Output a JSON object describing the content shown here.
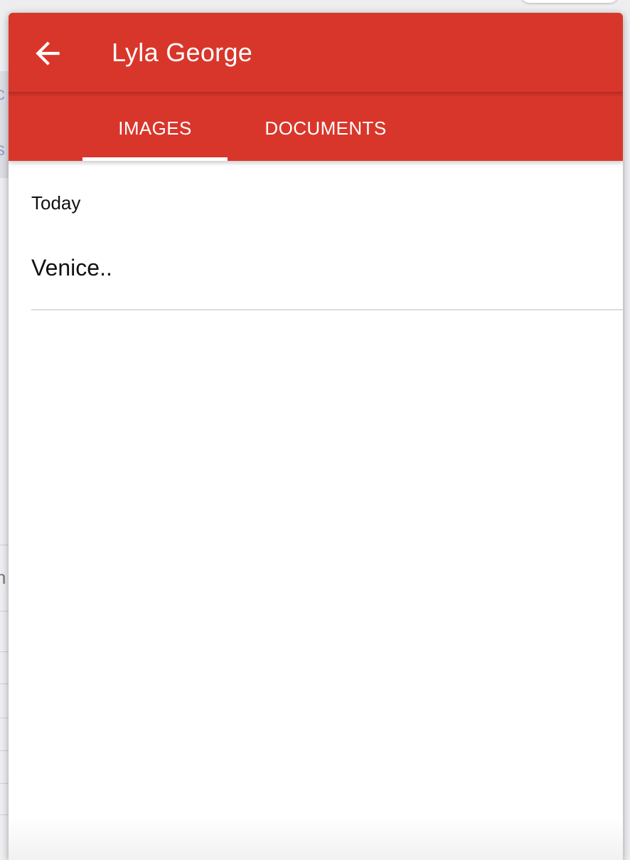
{
  "header": {
    "title": "Lyla George",
    "back_icon": "arrow-left-icon"
  },
  "tabs": [
    {
      "label": "IMAGES",
      "selected": true
    },
    {
      "label": "DOCUMENTS",
      "selected": false
    }
  ],
  "content": {
    "section_header": "Today",
    "items": [
      {
        "label": "Venice.."
      }
    ]
  },
  "colors": {
    "primary": "#d9362b",
    "on_primary": "#ffffff",
    "text": "#111111",
    "divider": "#dcdcdc"
  }
}
